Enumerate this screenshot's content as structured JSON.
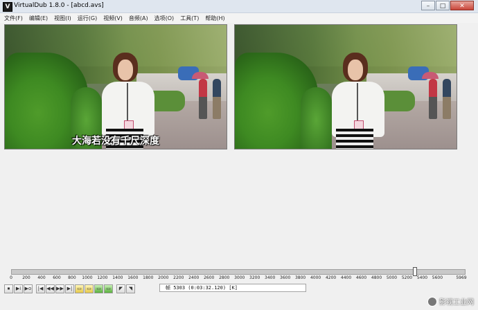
{
  "window": {
    "title": "VirtualDub 1.8.0 - [abcd.avs]",
    "app_icon_letter": "V",
    "min_label": "–",
    "max_label": "□",
    "close_label": "✕"
  },
  "menubar": {
    "items": [
      "文件(F)",
      "编辑(E)",
      "视图(I)",
      "运行(G)",
      "视频(V)",
      "音频(A)",
      "选项(O)",
      "工具(T)",
      "帮助(H)"
    ]
  },
  "video": {
    "subtitle": "大海若没有千尺深度"
  },
  "timeline": {
    "position_frame": 5303,
    "total_frames": 5969,
    "ticks": [
      "0",
      "200",
      "400",
      "600",
      "800",
      "1000",
      "1200",
      "1400",
      "1600",
      "1800",
      "2000",
      "2200",
      "2400",
      "2600",
      "2800",
      "3000",
      "3200",
      "3400",
      "3600",
      "3800",
      "4000",
      "4200",
      "4400",
      "4600",
      "4800",
      "5000",
      "5200",
      "5400",
      "5600"
    ],
    "end_label": "5969"
  },
  "toolbar": {
    "buttons": [
      "⏹",
      "▶i",
      "▶o",
      "|◀",
      "◀◀",
      "▶▶",
      "▶|",
      "▭",
      "▭",
      "▭",
      "▭",
      "◤",
      "◥"
    ]
  },
  "status": {
    "text": "帧  5303  (0:03:32.120)  [K]"
  },
  "watermark": {
    "text": "影视工业网"
  }
}
